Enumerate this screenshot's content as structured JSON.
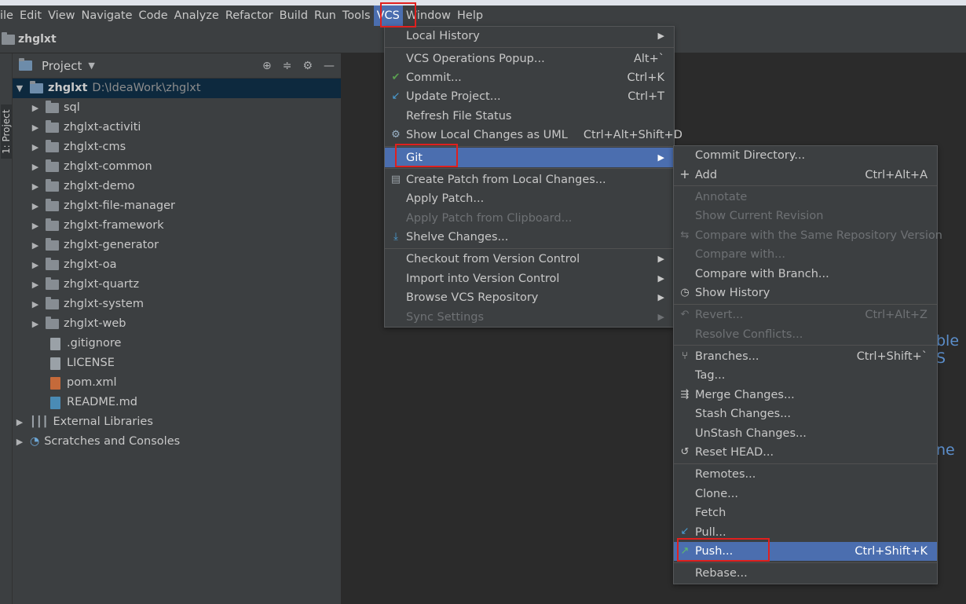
{
  "menubar": {
    "items": [
      "ile",
      "Edit",
      "View",
      "Navigate",
      "Code",
      "Analyze",
      "Refactor",
      "Build",
      "Run",
      "Tools",
      "VCS",
      "Window",
      "Help"
    ],
    "active": "VCS"
  },
  "navbar": {
    "project_name": "zhglxt"
  },
  "stripe": {
    "label": "1: Project"
  },
  "panel": {
    "title": "Project",
    "root": {
      "name": "zhglxt",
      "path": "D:\\IdeaWork\\zhglxt"
    },
    "folders": [
      "sql",
      "zhglxt-activiti",
      "zhglxt-cms",
      "zhglxt-common",
      "zhglxt-demo",
      "zhglxt-file-manager",
      "zhglxt-framework",
      "zhglxt-generator",
      "zhglxt-oa",
      "zhglxt-quartz",
      "zhglxt-system",
      "zhglxt-web"
    ],
    "files": [
      ".gitignore",
      "LICENSE",
      "pom.xml",
      "README.md"
    ],
    "external": "External Libraries",
    "scratches": "Scratches and Consoles"
  },
  "editor": {
    "hint1": "ble S",
    "hint2": "ne"
  },
  "vcs_menu": {
    "items": [
      {
        "label": "Local History",
        "sub": true
      },
      {
        "label": "VCS Operations Popup...",
        "shortcut": "Alt+`"
      },
      {
        "label": "Commit...",
        "shortcut": "Ctrl+K",
        "icon": "check-icon"
      },
      {
        "label": "Update Project...",
        "shortcut": "Ctrl+T",
        "icon": "update-arrow-icon"
      },
      {
        "label": "Refresh File Status"
      },
      {
        "label": "Show Local Changes as UML",
        "shortcut": "Ctrl+Alt+Shift+D",
        "icon": "uml-icon"
      },
      {
        "label": "Git",
        "sub": true
      },
      {
        "label": "Create Patch from Local Changes...",
        "icon": "patch-icon"
      },
      {
        "label": "Apply Patch..."
      },
      {
        "label": "Apply Patch from Clipboard...",
        "disabled": true
      },
      {
        "label": "Shelve Changes...",
        "icon": "shelve-icon"
      },
      {
        "label": "Checkout from Version Control",
        "sub": true
      },
      {
        "label": "Import into Version Control",
        "sub": true
      },
      {
        "label": "Browse VCS Repository",
        "sub": true
      },
      {
        "label": "Sync Settings",
        "sub": true,
        "disabled": true
      }
    ]
  },
  "git_menu": {
    "items": [
      {
        "label": "Commit Directory..."
      },
      {
        "label": "Add",
        "shortcut": "Ctrl+Alt+A",
        "icon": "plus-icon"
      },
      {
        "label": "Annotate",
        "disabled": true
      },
      {
        "label": "Show Current Revision",
        "disabled": true
      },
      {
        "label": "Compare with the Same Repository Version",
        "disabled": true,
        "icon": "compare-icon"
      },
      {
        "label": "Compare with...",
        "disabled": true
      },
      {
        "label": "Compare with Branch..."
      },
      {
        "label": "Show History",
        "icon": "clock-icon"
      },
      {
        "label": "Revert...",
        "shortcut": "Ctrl+Alt+Z",
        "disabled": true,
        "icon": "revert-icon"
      },
      {
        "label": "Resolve Conflicts...",
        "disabled": true
      },
      {
        "label": "Branches...",
        "shortcut": "Ctrl+Shift+`",
        "icon": "branch-icon"
      },
      {
        "label": "Tag..."
      },
      {
        "label": "Merge Changes...",
        "icon": "merge-icon"
      },
      {
        "label": "Stash Changes..."
      },
      {
        "label": "UnStash Changes..."
      },
      {
        "label": "Reset HEAD...",
        "icon": "reset-icon"
      },
      {
        "label": "Remotes..."
      },
      {
        "label": "Clone..."
      },
      {
        "label": "Fetch"
      },
      {
        "label": "Pull...",
        "icon": "pull-icon"
      },
      {
        "label": "Push...",
        "shortcut": "Ctrl+Shift+K",
        "icon": "push-icon"
      },
      {
        "label": "Rebase..."
      }
    ]
  },
  "colors": {
    "highlight": "#4b6eaf",
    "annotation": "#e0201e"
  }
}
